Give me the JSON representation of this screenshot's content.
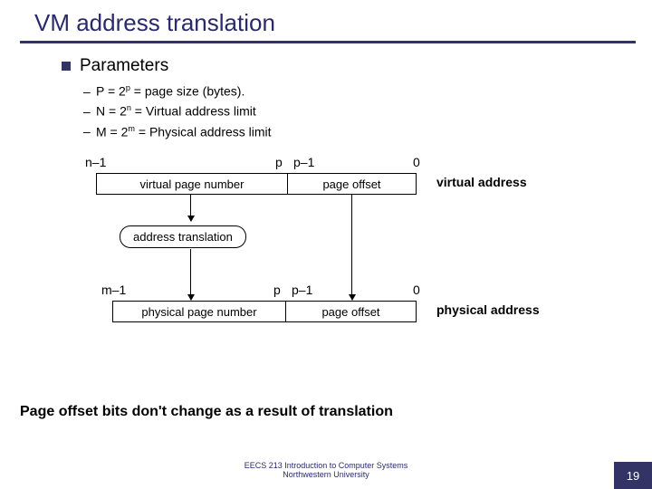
{
  "title": "VM address translation",
  "bullet": "Parameters",
  "sub": [
    {
      "text": "P = 2",
      "exp": "p",
      "rest": " = page size (bytes)."
    },
    {
      "text": "N = 2",
      "exp": "n",
      "rest": " = Virtual address limit"
    },
    {
      "text": "M = 2",
      "exp": "m",
      "rest": " = Physical address limit"
    }
  ],
  "va": {
    "n1": "n–1",
    "p": "p",
    "p1": "p–1",
    "zero": "0",
    "vpn": "virtual page number",
    "off": "page offset",
    "name": "virtual address"
  },
  "at": "address translation",
  "pa": {
    "m1": "m–1",
    "p": "p",
    "p1": "p–1",
    "zero": "0",
    "ppn": "physical page number",
    "off": "page offset",
    "name": "physical address"
  },
  "note": "Page offset bits don't change as a result of translation",
  "footer1": "EECS 213 Introduction to Computer Systems",
  "footer2": "Northwestern University",
  "page": "19"
}
